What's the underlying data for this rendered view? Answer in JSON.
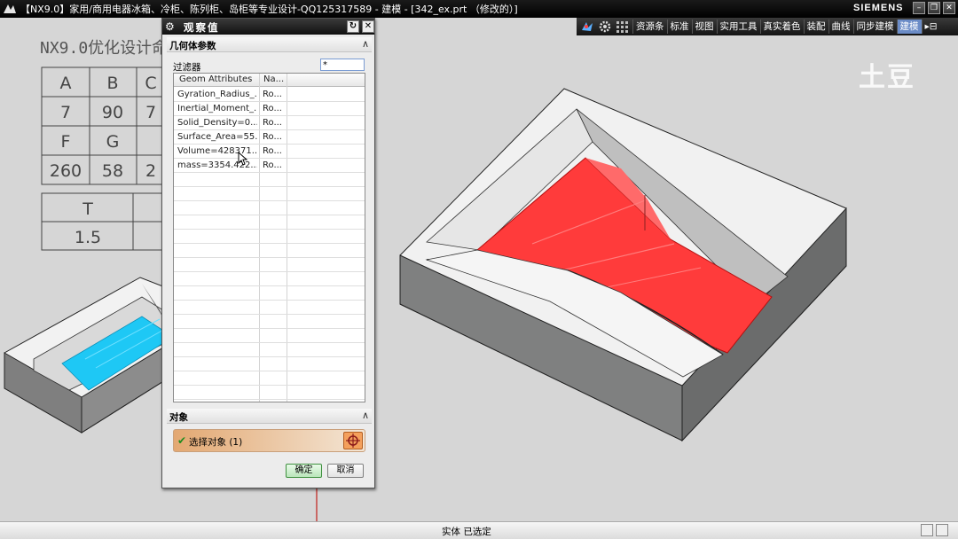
{
  "window": {
    "title": "【NX9.0】家用/商用电器冰箱、冷柜、陈列柜、岛柜等专业设计-QQ125317589 - 建模 - [342_ex.prt （修改的）]",
    "brand": "SIEMENS"
  },
  "toolbar": {
    "items": [
      "资源条",
      "标准",
      "视图",
      "实用工具",
      "真实着色",
      "装配",
      "曲线",
      "同步建模",
      "建模"
    ],
    "active": "建模"
  },
  "sketch_table": {
    "heading": "NX9.0优化设计命令",
    "rows": [
      [
        "A",
        "B",
        "C"
      ],
      [
        "7",
        "90",
        "7"
      ],
      [
        "F",
        "G",
        ""
      ],
      [
        "260",
        "58",
        "2"
      ]
    ],
    "t_rows": [
      [
        "T",
        ""
      ],
      [
        "1.5",
        ""
      ]
    ]
  },
  "watermark": "土豆",
  "dialog": {
    "title": "观察值",
    "section_geom": "几何体参数",
    "filter_label": "过滤器",
    "filter_value": "*",
    "columns": [
      "Geom Attributes",
      "Na..."
    ],
    "rows": [
      {
        "attr": "Gyration_Radius_...",
        "name": "Ro..."
      },
      {
        "attr": "Inertial_Moment_...",
        "name": "Ro..."
      },
      {
        "attr": "Solid_Density=0....",
        "name": "Ro..."
      },
      {
        "attr": "Surface_Area=55...",
        "name": "Ro..."
      },
      {
        "attr": "Volume=428371...",
        "name": "Ro..."
      },
      {
        "attr": "mass=3354.422...",
        "name": "Ro..."
      }
    ],
    "section_object": "对象",
    "select_label": "选择对象 (1)",
    "ok_label": "确定",
    "cancel_label": "取消"
  },
  "status": {
    "text": "实体 已选定"
  },
  "colors": {
    "highlight_face": "#ff3b3b",
    "preview_face": "#1ec8f5",
    "dialog_accent": "#f4a05c"
  }
}
